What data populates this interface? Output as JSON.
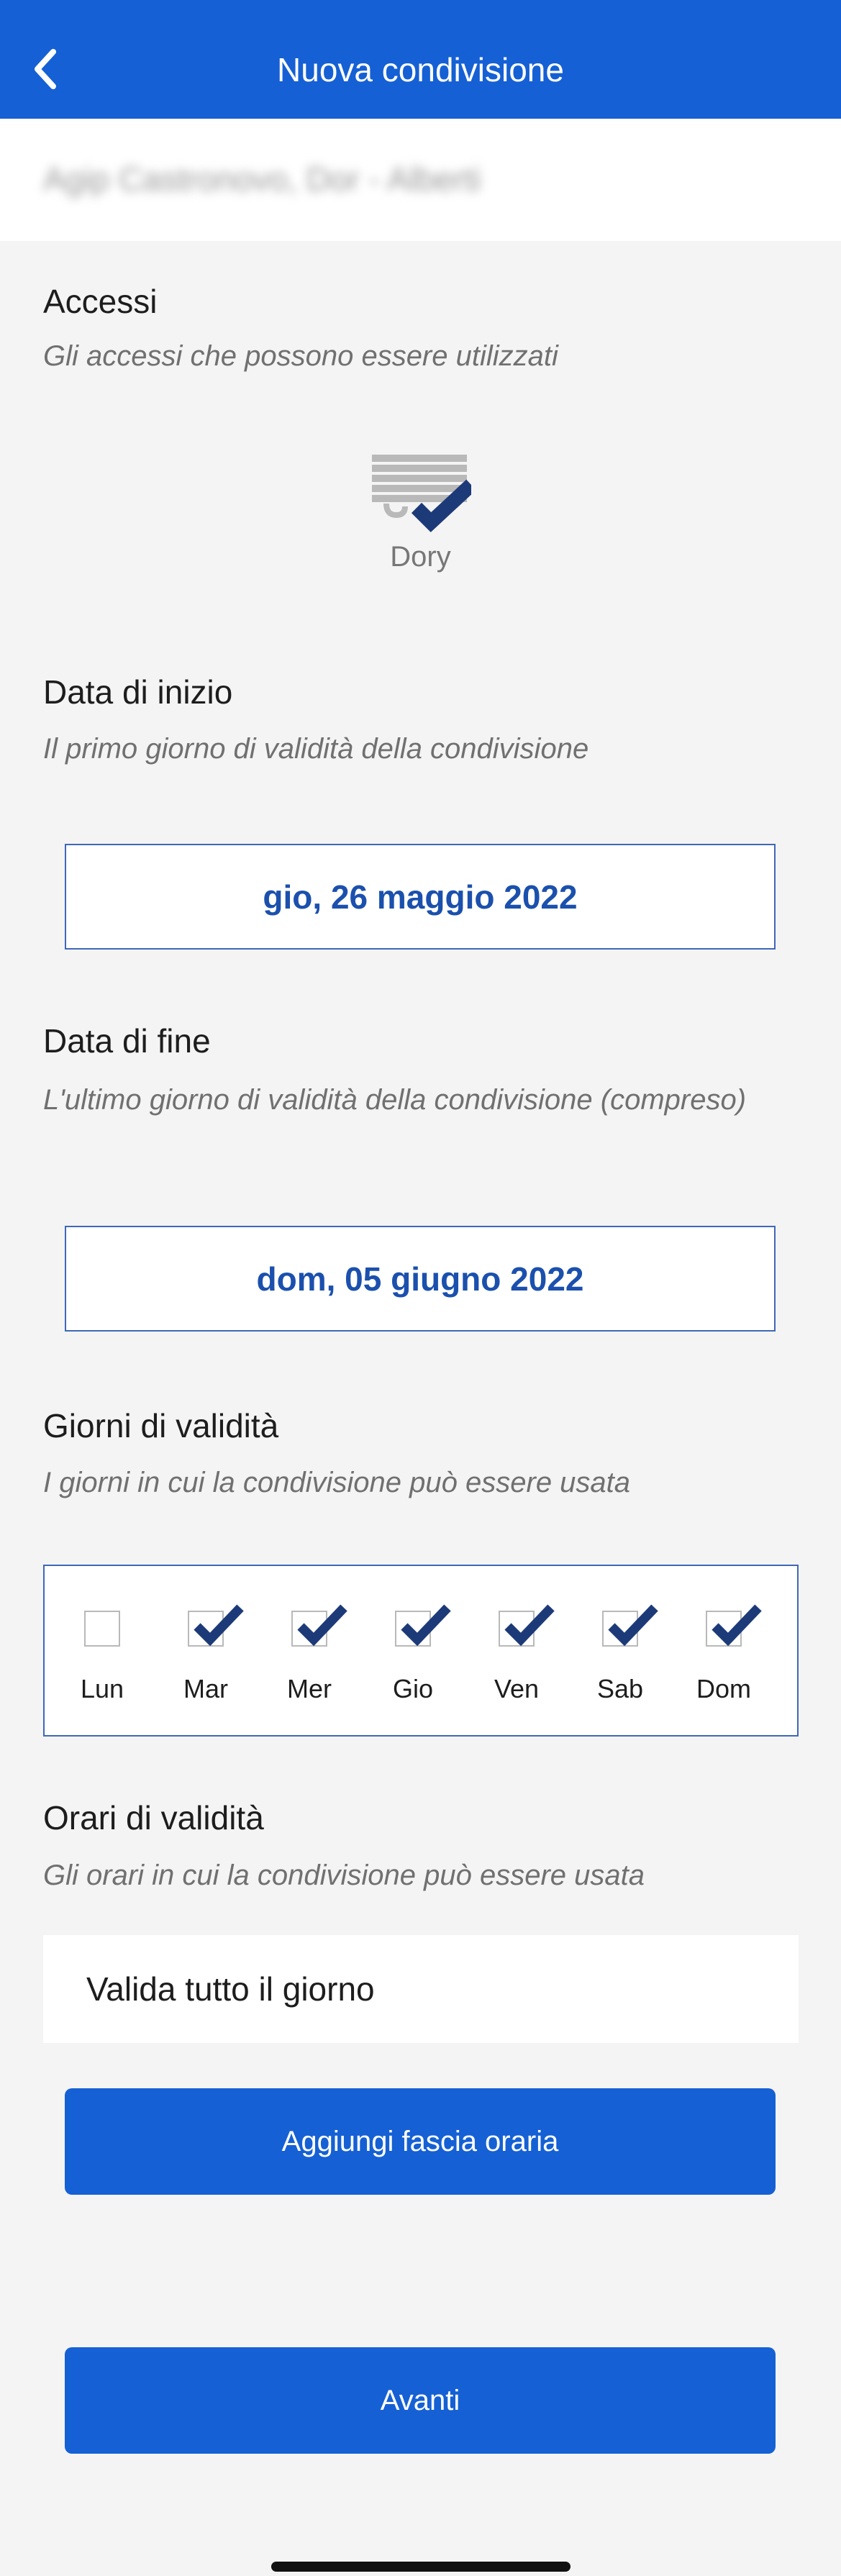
{
  "header": {
    "title": "Nuova condivisione",
    "back_icon": "chevron-left-icon"
  },
  "subheader": {
    "text": "Agip Castronovo, Dor - Alberti"
  },
  "accessi": {
    "title": "Accessi",
    "subtitle": "Gli accessi che possono essere utilizzati",
    "item": {
      "label": "Dory",
      "icon": "shutter-check-icon"
    }
  },
  "data_inizio": {
    "title": "Data di inizio",
    "subtitle": "Il primo giorno di validità della condivisione",
    "value": "gio, 26 maggio 2022"
  },
  "data_fine": {
    "title": "Data di fine",
    "subtitle": "L'ultimo giorno di validità della condivisione (compreso)",
    "value": "dom, 05 giugno 2022"
  },
  "giorni": {
    "title": "Giorni di validità",
    "subtitle": "I giorni in cui la condivisione può essere usata",
    "days": [
      {
        "label": "Lun",
        "checked": false
      },
      {
        "label": "Mar",
        "checked": true
      },
      {
        "label": "Mer",
        "checked": true
      },
      {
        "label": "Gio",
        "checked": true
      },
      {
        "label": "Ven",
        "checked": true
      },
      {
        "label": "Sab",
        "checked": true
      },
      {
        "label": "Dom",
        "checked": true
      }
    ]
  },
  "orari": {
    "title": "Orari di validità",
    "subtitle": "Gli orari in cui la condivisione può essere usata",
    "all_day": "Valida tutto il giorno",
    "add_button": "Aggiungi fascia oraria"
  },
  "next_button": "Avanti",
  "colors": {
    "primary": "#1560d4",
    "check": "#1d3a78",
    "date_text": "#1b50ad"
  }
}
